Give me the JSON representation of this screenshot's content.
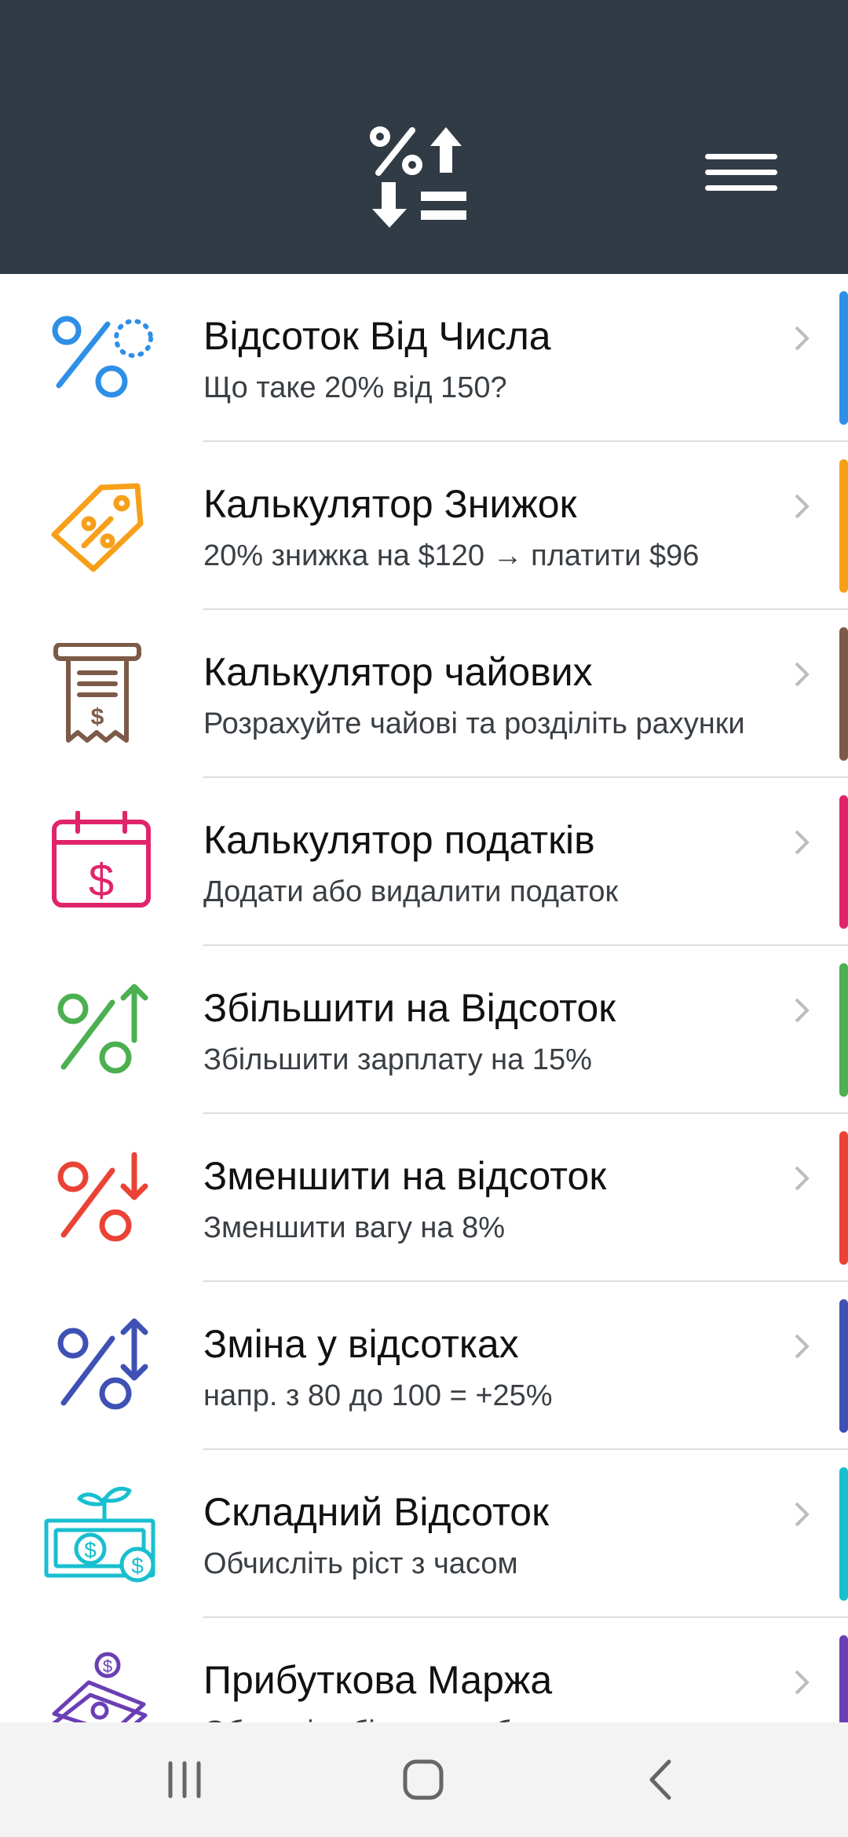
{
  "header": {
    "logo_icon": "percent-arrows-icon",
    "menu_icon": "hamburger-menu-icon",
    "background": "#303b45"
  },
  "items": [
    {
      "title": "Відсоток Від Числа",
      "subtitle": "Що таке 20% від 150?",
      "color": "#2f8fe6",
      "icon": "percent-dots-icon"
    },
    {
      "title": "Калькулятор Знижок",
      "subtitle": "20% знижка на $120 → платити $96",
      "color": "#f6a01a",
      "icon": "price-tag-icon"
    },
    {
      "title": "Калькулятор чайових",
      "subtitle": "Розрахуйте чайові та розділіть рахунки",
      "color": "#7d5a48",
      "icon": "receipt-icon"
    },
    {
      "title": "Калькулятор податків",
      "subtitle": "Додати або видалити податок",
      "color": "#e0246b",
      "icon": "tax-calendar-icon"
    },
    {
      "title": "Збільшити на Відсоток",
      "subtitle": "Збільшити зарплату на 15%",
      "color": "#4caf50",
      "icon": "percent-up-icon"
    },
    {
      "title": "Зменшити на відсоток",
      "subtitle": "Зменшити вагу на 8%",
      "color": "#ea4335",
      "icon": "percent-down-icon"
    },
    {
      "title": "Зміна у відсотках",
      "subtitle": "напр. з 80 до 100 = +25%",
      "color": "#3f51b5",
      "icon": "percent-updown-icon"
    },
    {
      "title": "Складний Відсоток",
      "subtitle": "Обчисліть ріст з часом",
      "color": "#18bfcf",
      "icon": "money-plant-icon"
    },
    {
      "title": "Прибуткова Маржа",
      "subtitle": "Обчисліть бізнес прибуток",
      "color": "#6a3fb5",
      "icon": "money-stack-icon"
    }
  ],
  "navbar": {
    "recents_icon": "recents-icon",
    "home_icon": "home-icon",
    "back_icon": "back-icon"
  }
}
